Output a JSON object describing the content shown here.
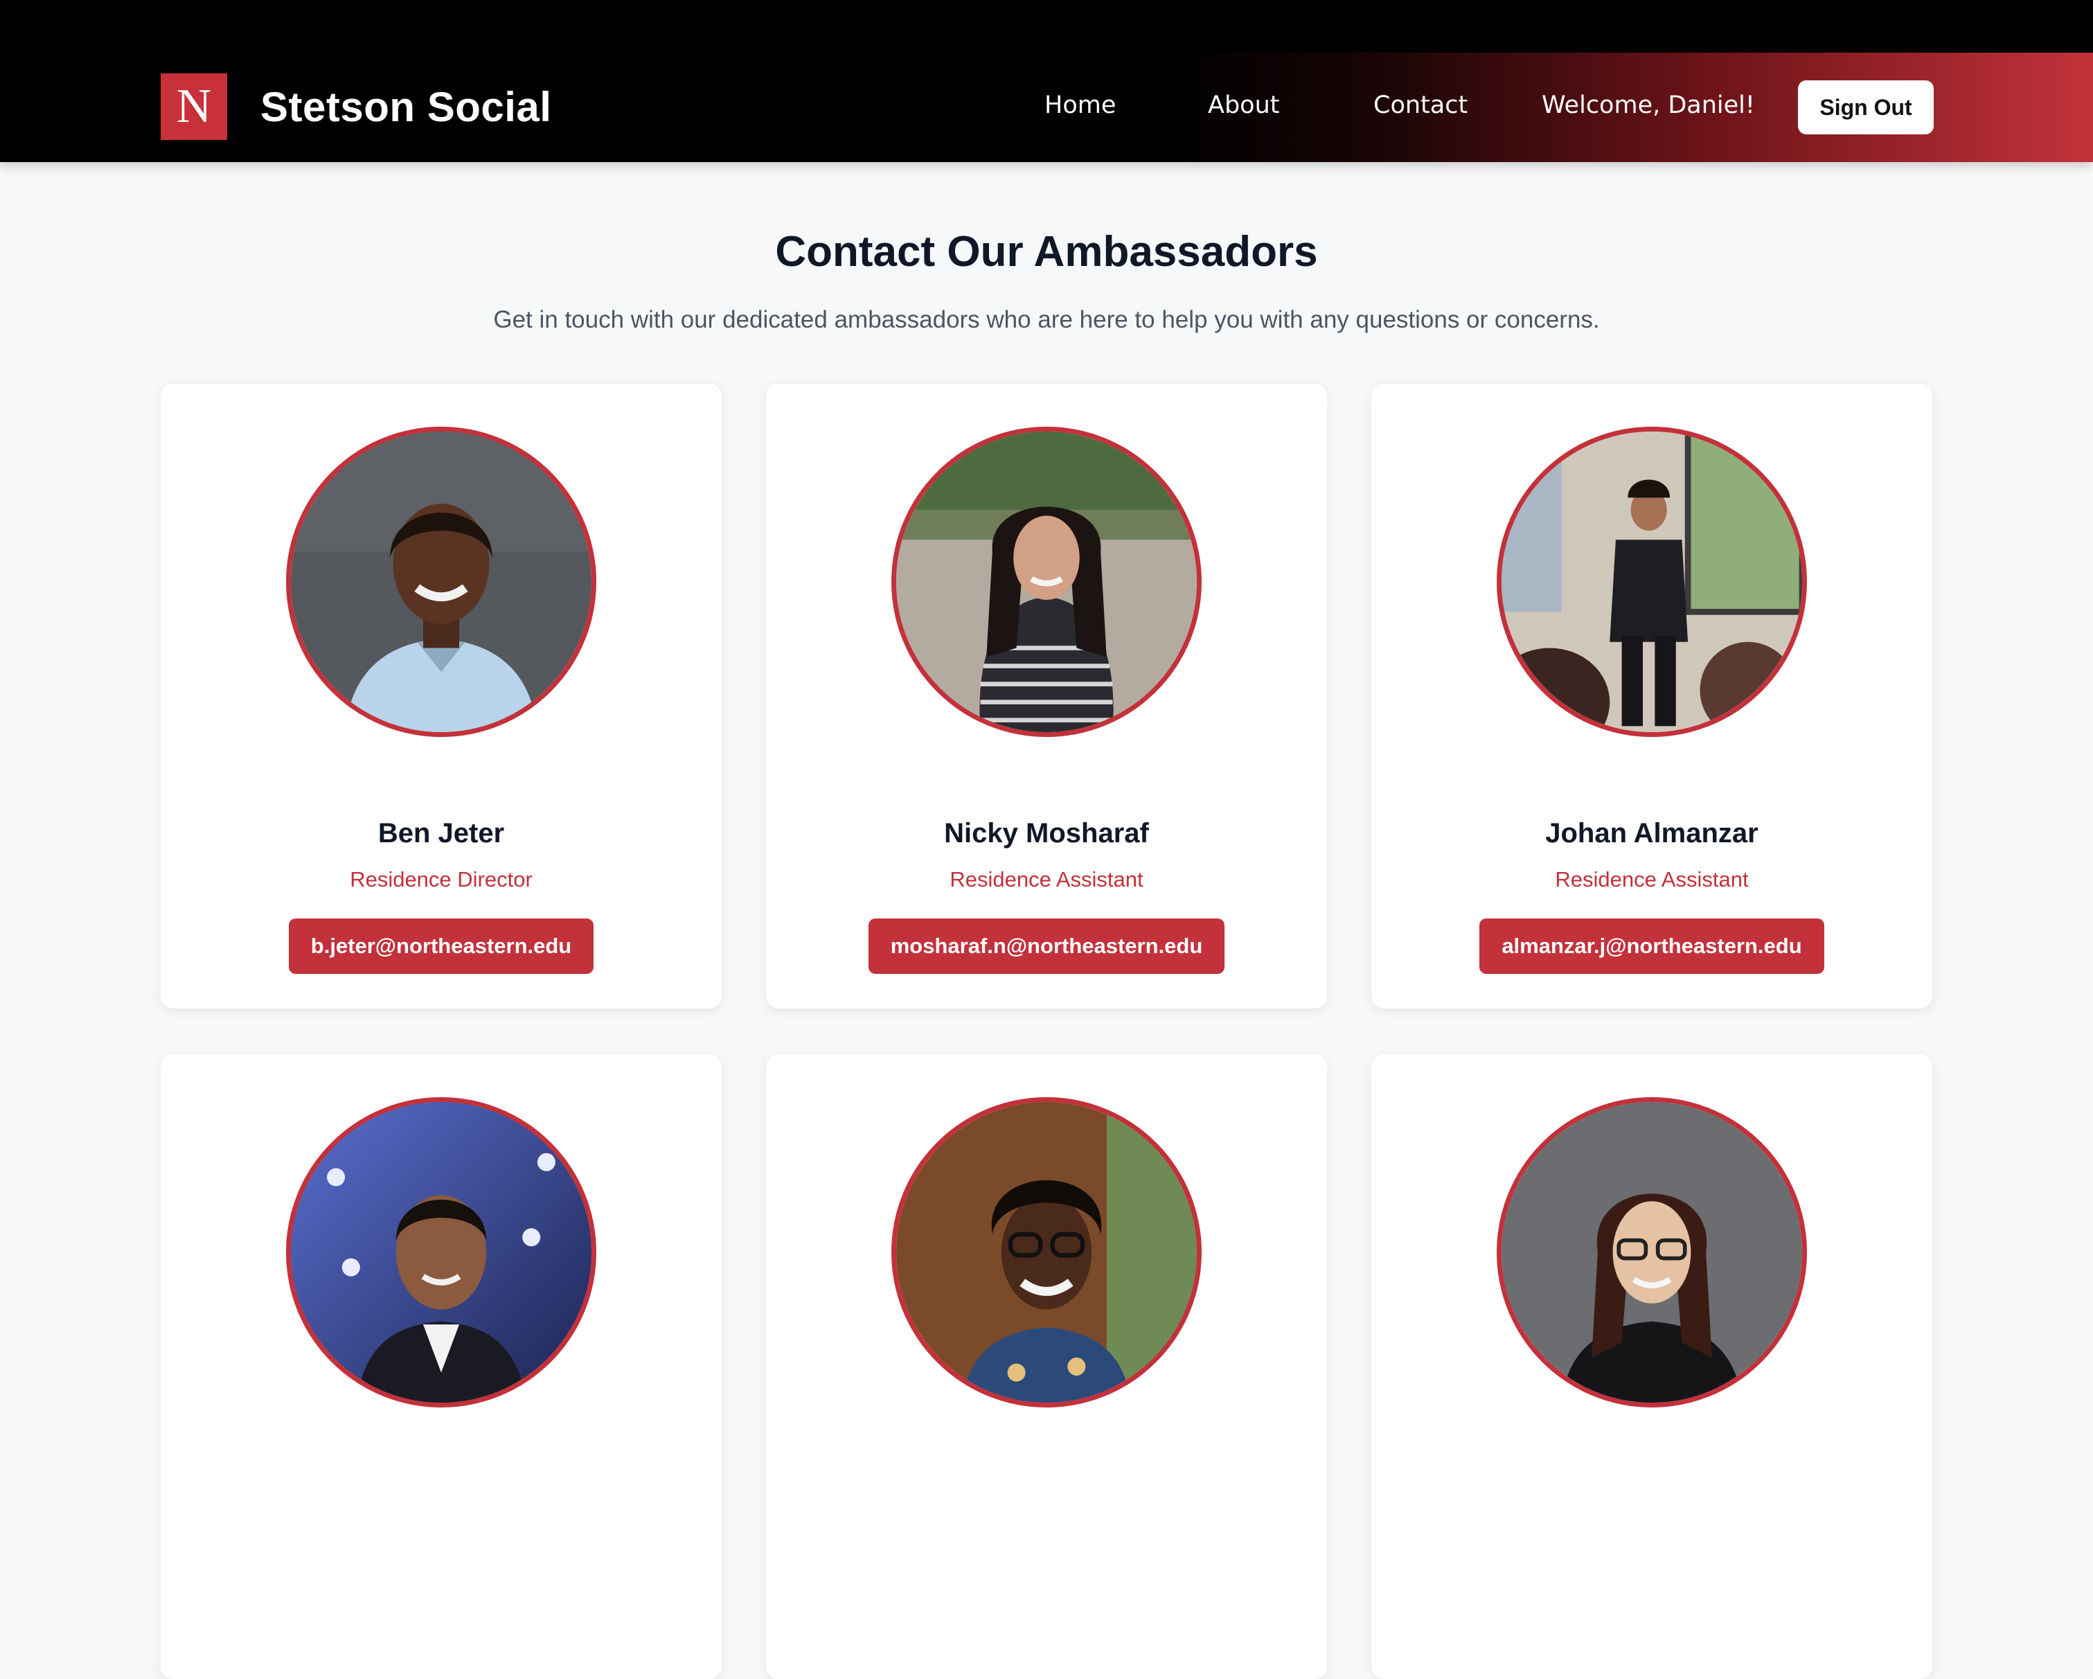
{
  "nav": {
    "logo_letter": "N",
    "brand": "Stetson Social",
    "links": [
      "Home",
      "About",
      "Contact"
    ],
    "welcome": "Welcome, Daniel!",
    "sign_out": "Sign Out"
  },
  "page": {
    "title": "Contact Our Ambassadors",
    "subtitle": "Get in touch with our dedicated ambassadors who are here to help you with any questions or concerns."
  },
  "ambassadors": [
    {
      "name": "Ben Jeter",
      "role": "Residence Director",
      "email": "b.jeter@northeastern.edu"
    },
    {
      "name": "Nicky Mosharaf",
      "role": "Residence Assistant",
      "email": "mosharaf.n@northeastern.edu"
    },
    {
      "name": "Johan Almanzar",
      "role": "Residence Assistant",
      "email": "almanzar.j@northeastern.edu"
    },
    {
      "name": "",
      "role": "",
      "email": ""
    },
    {
      "name": "",
      "role": "",
      "email": ""
    },
    {
      "name": "",
      "role": "",
      "email": ""
    }
  ],
  "colors": {
    "accent": "#c3313a",
    "header_bg": "#000000",
    "page_bg": "#f7f8fa",
    "title_text": "#101828"
  }
}
